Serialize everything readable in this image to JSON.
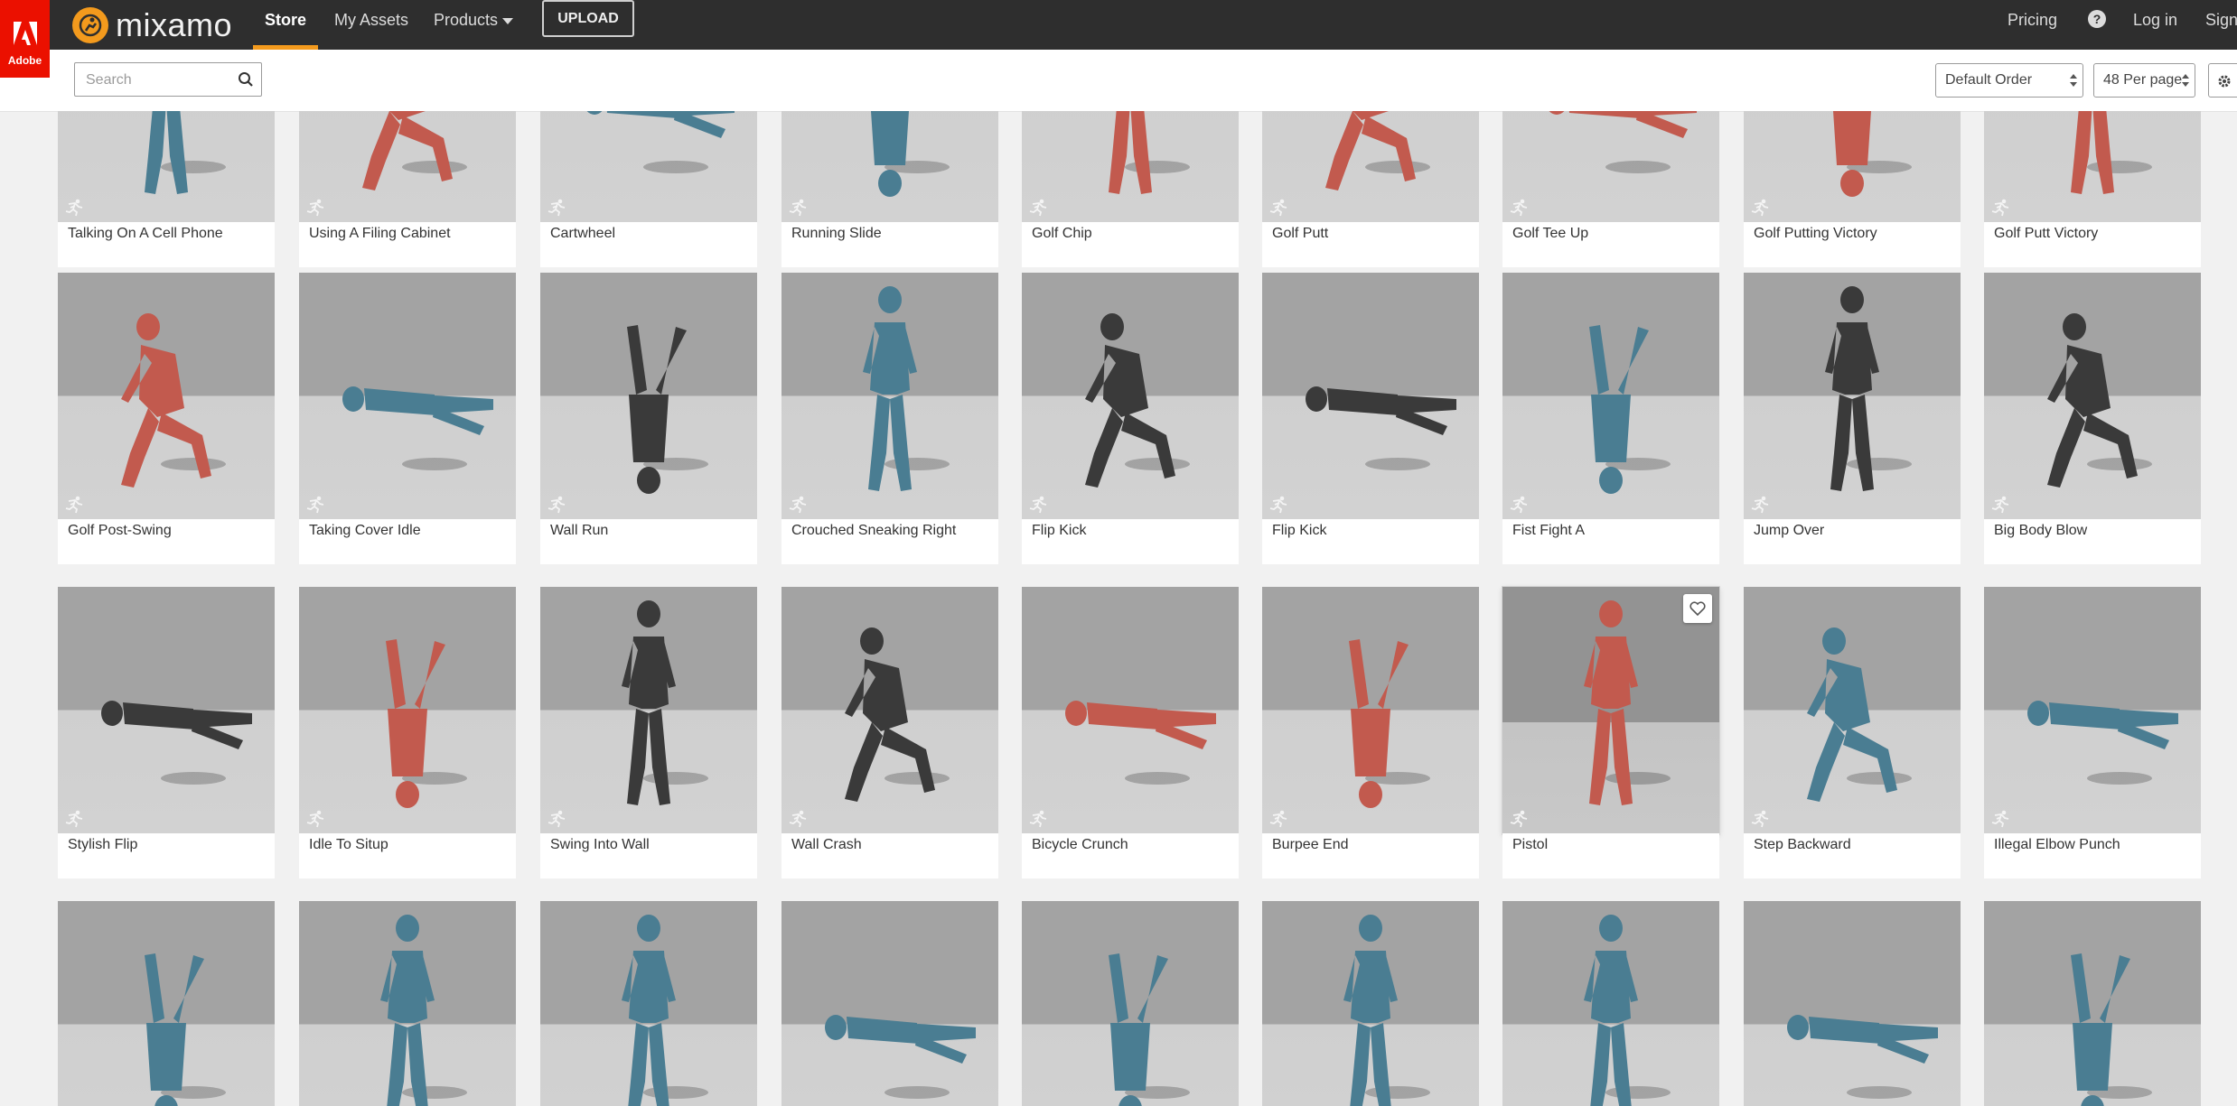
{
  "brand": {
    "adobe_label": "Adobe",
    "name": "mixamo"
  },
  "nav": {
    "store": "Store",
    "my_assets": "My Assets",
    "products": "Products",
    "upload": "UPLOAD",
    "pricing": "Pricing",
    "login": "Log in",
    "signup": "Sign"
  },
  "toolbar": {
    "search_placeholder": "Search",
    "sort_value": "Default Order",
    "per_page_value": "48 Per page"
  },
  "colors": {
    "accent": "#f39a1d",
    "adobe_red": "#eb1000",
    "nav_bg": "#2e2e2e",
    "blue_figure": "#4a7d92",
    "red_figure": "#c25a4e",
    "dark_figure": "#3a3a3a"
  },
  "animations": [
    {
      "title": "Talking On A Cell Phone",
      "figure": "blue"
    },
    {
      "title": "Using A Filing Cabinet",
      "figure": "red"
    },
    {
      "title": "Cartwheel",
      "figure": "blue"
    },
    {
      "title": "Running Slide",
      "figure": "blue"
    },
    {
      "title": "Golf Chip",
      "figure": "red"
    },
    {
      "title": "Golf Putt",
      "figure": "red"
    },
    {
      "title": "Golf Tee Up",
      "figure": "red"
    },
    {
      "title": "Golf Putting Victory",
      "figure": "red"
    },
    {
      "title": "Golf Putt Victory",
      "figure": "red"
    },
    {
      "title": "Golf Post-Swing",
      "figure": "red"
    },
    {
      "title": "Taking Cover Idle",
      "figure": "blue"
    },
    {
      "title": "Wall Run",
      "figure": "dark"
    },
    {
      "title": "Crouched Sneaking Right",
      "figure": "blue"
    },
    {
      "title": "Flip Kick",
      "figure": "dark"
    },
    {
      "title": "Flip Kick",
      "figure": "dark"
    },
    {
      "title": "Fist Fight A",
      "figure": "blue"
    },
    {
      "title": "Jump Over",
      "figure": "dark"
    },
    {
      "title": "Big Body Blow",
      "figure": "dark"
    },
    {
      "title": "Stylish Flip",
      "figure": "dark"
    },
    {
      "title": "Idle To Situp",
      "figure": "red"
    },
    {
      "title": "Swing Into Wall",
      "figure": "dark"
    },
    {
      "title": "Wall Crash",
      "figure": "dark"
    },
    {
      "title": "Bicycle Crunch",
      "figure": "red"
    },
    {
      "title": "Burpee End",
      "figure": "red"
    },
    {
      "title": "Pistol",
      "figure": "red",
      "hovered": true
    },
    {
      "title": "Step Backward",
      "figure": "blue"
    },
    {
      "title": "Illegal Elbow Punch",
      "figure": "blue"
    },
    {
      "title": "",
      "figure": "blue"
    },
    {
      "title": "",
      "figure": "blue"
    },
    {
      "title": "",
      "figure": "blue"
    },
    {
      "title": "",
      "figure": "blue"
    },
    {
      "title": "",
      "figure": "blue"
    },
    {
      "title": "",
      "figure": "blue"
    },
    {
      "title": "",
      "figure": "blue"
    },
    {
      "title": "",
      "figure": "blue"
    },
    {
      "title": "",
      "figure": "blue"
    }
  ]
}
